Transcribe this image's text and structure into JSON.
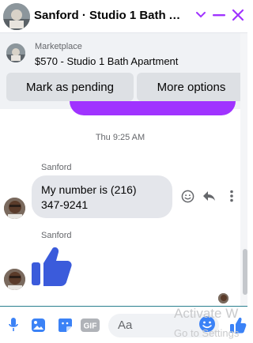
{
  "header": {
    "title": "Sanford · Studio 1 Bath Ap…",
    "avatar_icon": "contact-avatar-photo",
    "icons": [
      "chevron-down-icon",
      "minimize-icon",
      "close-icon"
    ],
    "accent": "#a033ff"
  },
  "marketplace": {
    "label": "Marketplace",
    "item": "$570 - Studio 1 Bath Apartment",
    "buttons": {
      "pending": "Mark as pending",
      "more": "More options"
    }
  },
  "conversation": {
    "timestamp": "Thu 9:25 AM",
    "messages": [
      {
        "sender": "Sanford",
        "text": "My number is (216) 347-9241",
        "lines": [
          "My number is (216)",
          "347-9241"
        ]
      },
      {
        "sender": "Sanford",
        "text": "",
        "sticker": "thumbs-up-icon"
      }
    ],
    "message_actions": [
      "react-emoji-icon",
      "reply-icon",
      "more-options-icon"
    ]
  },
  "composer": {
    "placeholder": "Aa",
    "tools": [
      "microphone-icon",
      "photo-icon",
      "sticker-icon",
      "gif-icon"
    ],
    "gif_label": "GIF",
    "emoji": "emoji-icon",
    "send_like": "like-icon"
  },
  "watermark": {
    "line1": "Activate W",
    "line2": "Go to Settings"
  }
}
